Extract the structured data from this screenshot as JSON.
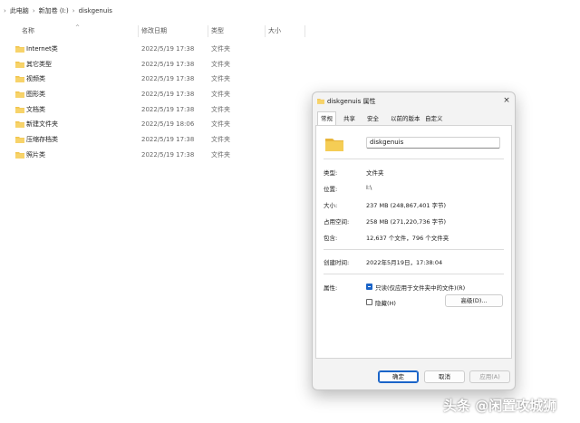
{
  "breadcrumb": {
    "chevron": "›",
    "items": [
      "此电脑",
      "新加卷 (I:)",
      "diskgenuis"
    ]
  },
  "columns": [
    "名称",
    "修改日期",
    "类型",
    "大小"
  ],
  "files": [
    {
      "name": "Internet类",
      "date": "2022/5/19 17:38",
      "type": "文件夹"
    },
    {
      "name": "其它类型",
      "date": "2022/5/19 17:38",
      "type": "文件夹"
    },
    {
      "name": "视频类",
      "date": "2022/5/19 17:38",
      "type": "文件夹"
    },
    {
      "name": "图形类",
      "date": "2022/5/19 17:38",
      "type": "文件夹"
    },
    {
      "name": "文档类",
      "date": "2022/5/19 17:38",
      "type": "文件夹"
    },
    {
      "name": "新建文件夹",
      "date": "2022/5/19 18:06",
      "type": "文件夹"
    },
    {
      "name": "压缩存档类",
      "date": "2022/5/19 17:38",
      "type": "文件夹"
    },
    {
      "name": "照片类",
      "date": "2022/5/19 17:38",
      "type": "文件夹"
    }
  ],
  "dialog": {
    "title": "diskgenuis 属性",
    "close": "×",
    "tabs": [
      "常规",
      "共享",
      "安全",
      "以前的版本",
      "自定义"
    ],
    "folder_name": "diskgenuis",
    "props": [
      {
        "label": "类型:",
        "value": "文件夹"
      },
      {
        "label": "位置:",
        "value": "I:\\"
      },
      {
        "label": "大小:",
        "value": "237 MB (248,867,401 字节)"
      },
      {
        "label": "占用空间:",
        "value": "258 MB (271,220,736 字节)"
      },
      {
        "label": "包含:",
        "value": "12,637 个文件，796 个文件夹"
      },
      {
        "label": "创建时间:",
        "value": "2022年5月19日，17:38:04"
      }
    ],
    "attributes_label": "属性:",
    "readonly_label": "只读(仅应用于文件夹中的文件)(R)",
    "hidden_label": "隐藏(H)",
    "advanced_button": "高级(D)...",
    "ok_button": "确定",
    "cancel_button": "取消",
    "apply_button": "应用(A)"
  },
  "watermark": "头条 @闲置攻城狮",
  "colors": {
    "accent": "#1a64c8",
    "folder": "#f2c44c"
  }
}
